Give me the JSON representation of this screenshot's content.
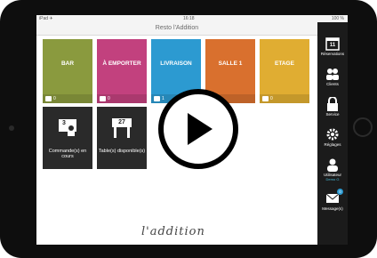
{
  "statusbar": {
    "left": "iPad ✈",
    "center": "16:18",
    "right": "100 %"
  },
  "app_title": "Resto l'Addition",
  "tiles": [
    {
      "label": "BAR",
      "count": "0",
      "color": "#8a9a3e"
    },
    {
      "label": "À EMPORTER",
      "count": "0",
      "color": "#c2417e"
    },
    {
      "label": "LIVRAISON",
      "count": "1",
      "color": "#2c9ad1"
    },
    {
      "label": "SALLE 1",
      "count": "0",
      "color": "#d9702e"
    },
    {
      "label": "ETAGE",
      "count": "0",
      "color": "#e0ad32"
    }
  ],
  "dark_tiles": [
    {
      "number": "3",
      "caption": "Commande(s) en cours"
    },
    {
      "number": "27",
      "caption": "Table(s) disponible(s)"
    }
  ],
  "sidebar": {
    "items": [
      {
        "label": "Réservations",
        "icon": "calendar-icon",
        "date": "11"
      },
      {
        "label": "Clients",
        "icon": "users-icon"
      },
      {
        "label": "Service",
        "icon": "lock-icon"
      },
      {
        "label": "Réglages",
        "icon": "gear-icon"
      },
      {
        "label": "Utilisateur",
        "sub": "Demo G",
        "icon": "user-icon"
      },
      {
        "label": "Message(s)",
        "icon": "mail-icon",
        "badge": "0"
      }
    ]
  },
  "logo_text": "l'addition"
}
